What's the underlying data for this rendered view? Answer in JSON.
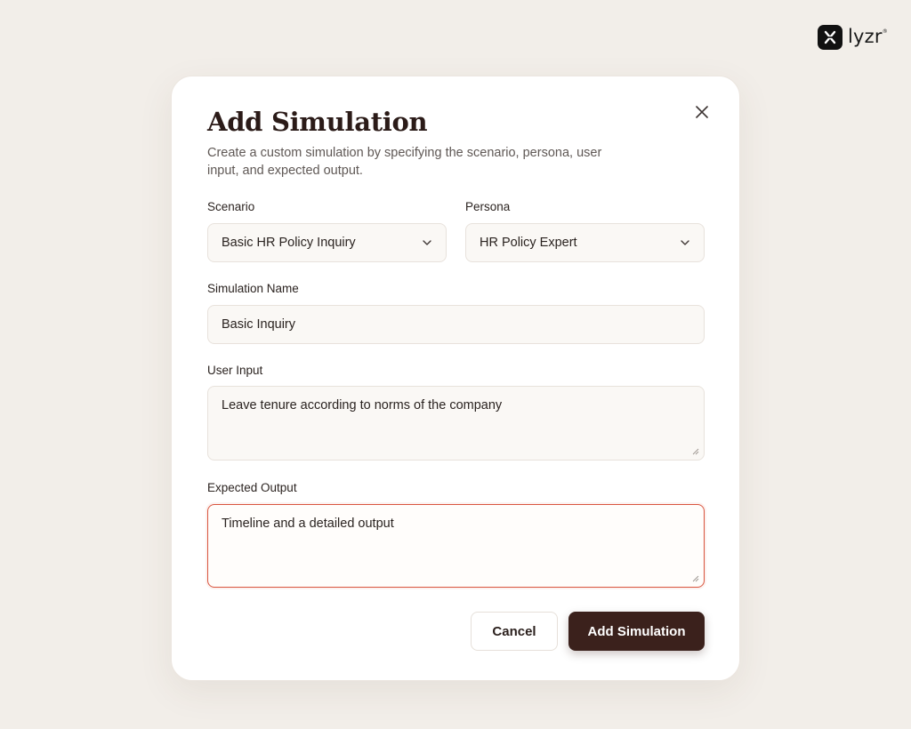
{
  "brand": {
    "name": "lyzr",
    "mark": "®"
  },
  "modal": {
    "title": "Add Simulation",
    "subtitle": "Create a custom simulation by specifying the scenario, persona, user input, and expected output."
  },
  "fields": {
    "scenario": {
      "label": "Scenario",
      "value": "Basic HR Policy Inquiry"
    },
    "persona": {
      "label": "Persona",
      "value": "HR Policy Expert"
    },
    "simulation_name": {
      "label": "Simulation Name",
      "value": "Basic Inquiry"
    },
    "user_input": {
      "label": "User Input",
      "value": "Leave tenure according to norms of the company"
    },
    "expected_output": {
      "label": "Expected Output",
      "value": "Timeline and a detailed output"
    }
  },
  "buttons": {
    "cancel": "Cancel",
    "submit": "Add Simulation"
  },
  "colors": {
    "accent": "#3b211c",
    "focus_border": "#d9553f",
    "background": "#f2eee9"
  }
}
